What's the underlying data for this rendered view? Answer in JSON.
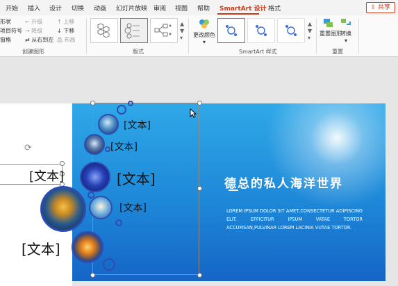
{
  "tabs": [
    "开始",
    "插入",
    "设计",
    "切换",
    "动画",
    "幻灯片放映",
    "审阅",
    "视图",
    "帮助",
    "SmartArt 设计",
    "格式"
  ],
  "share_label": "共享",
  "create_group": {
    "label": "创建图形",
    "items": [
      "形状",
      "项目符号",
      "窗格",
      "升级",
      "降级",
      "从右到左",
      "上移",
      "下移",
      "布局"
    ]
  },
  "layout_group": {
    "label": "版式"
  },
  "style_group": {
    "label": "SmartArt 样式",
    "change_color": "更改颜色"
  },
  "reset_group": {
    "label": "重置",
    "reset_graphic": "重置图形",
    "convert": "转换"
  },
  "smartart": {
    "node_labels": [
      "[文本]",
      "[文本]",
      "[文本]",
      "[文本]",
      "[文本]",
      "[文本]"
    ]
  },
  "slide": {
    "title": "德总的私人海洋世界",
    "body": "LOREM IPSUM DOLOR SIT AMET,CONSECTETUR ADIPISCING ELIT. EFFICITUR IPSUM VATAE TORTOR ACCUMSAN,PULVINAR LOREM LACINIA VUTAE TORTOR."
  },
  "colors": {
    "accent": "#c43e1c",
    "bubble_border": "#2d4db5",
    "slide_blue": "#1e88d8"
  }
}
